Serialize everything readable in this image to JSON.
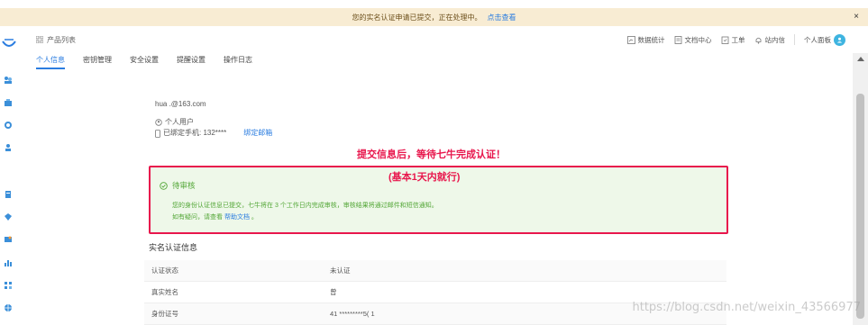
{
  "notice": {
    "text": "您的实名认证申请已提交，正在处理中。",
    "link_text": "点击查看",
    "close": "×"
  },
  "topbar": {
    "product_list": "产品列表",
    "items": [
      {
        "label": "数据统计",
        "icon": "chart-icon"
      },
      {
        "label": "文档中心",
        "icon": "document-icon"
      },
      {
        "label": "工单",
        "icon": "ticket-icon"
      },
      {
        "label": "站内信",
        "icon": "bell-icon"
      },
      {
        "label": "个人面板",
        "icon": "avatar"
      }
    ]
  },
  "tabs": [
    {
      "label": "个人信息",
      "active": true
    },
    {
      "label": "密钥管理",
      "active": false
    },
    {
      "label": "安全设置",
      "active": false
    },
    {
      "label": "提醒设置",
      "active": false
    },
    {
      "label": "操作日志",
      "active": false
    }
  ],
  "user": {
    "email": "hua  .@163.com",
    "type": "个人用户",
    "phone": "已绑定手机: 132****",
    "bind_email": "绑定邮箱"
  },
  "annotations": {
    "line1": "提交信息后，等待七牛完成认证！",
    "line2": "(基本1天内就行)"
  },
  "review": {
    "status": "待审核",
    "text1": "您的身份认证信息已提交，七牛将在 3 个工作日内完成审核，审核结果将通过邮件和短信通知。",
    "text2_prefix": "如有疑问，请查看",
    "text2_link": "帮助文档",
    "text2_suffix": "。"
  },
  "section": {
    "title": "实名认证信息",
    "rows": [
      {
        "label": "认证状态",
        "value": "未认证"
      },
      {
        "label": "真实姓名",
        "value": "曾"
      },
      {
        "label": "身份证号",
        "value": "41   *********5(   1"
      }
    ]
  },
  "watermark": "https://blog.csdn.net/weixin_43566977",
  "colors": {
    "accent": "#2b7de0",
    "annotation": "#e8164c",
    "success": "#52a636",
    "notice_bg": "#f8ecd3"
  }
}
